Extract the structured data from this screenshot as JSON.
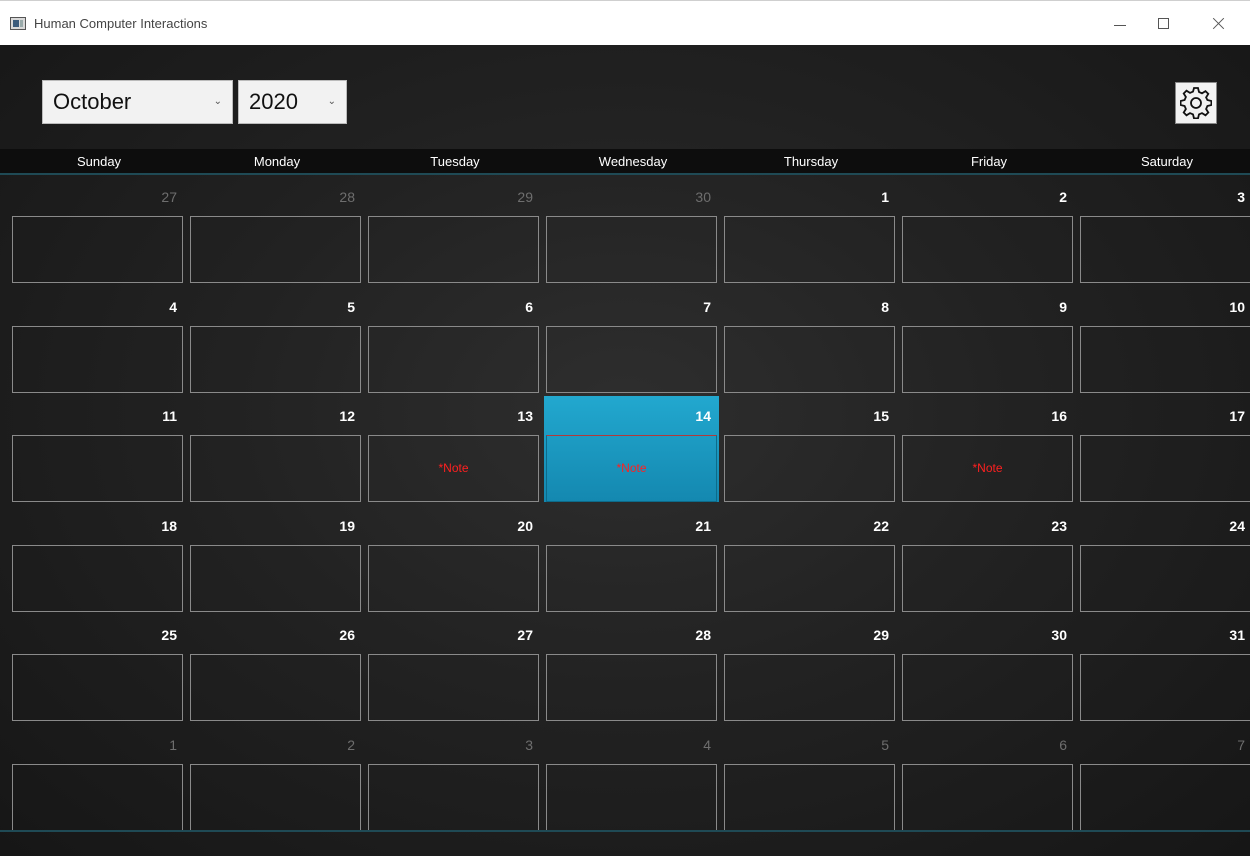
{
  "window": {
    "title": "Human Computer Interactions",
    "minimize": "minimize",
    "maximize": "maximize",
    "close": "close"
  },
  "controls": {
    "month": "October",
    "year": "2020",
    "settings_icon": "gear-icon"
  },
  "weekdays": [
    "Sunday",
    "Monday",
    "Tuesday",
    "Wednesday",
    "Thursday",
    "Friday",
    "Saturday"
  ],
  "colors": {
    "selected": "#1a9cc4",
    "note": "#ff2020",
    "muted": "#6e6e6e"
  },
  "calendar": {
    "selected_day": 14,
    "weeks": [
      [
        {
          "day": "27",
          "muted": true,
          "note": ""
        },
        {
          "day": "28",
          "muted": true,
          "note": ""
        },
        {
          "day": "29",
          "muted": true,
          "note": ""
        },
        {
          "day": "30",
          "muted": true,
          "note": ""
        },
        {
          "day": "1",
          "muted": false,
          "note": ""
        },
        {
          "day": "2",
          "muted": false,
          "note": ""
        },
        {
          "day": "3",
          "muted": false,
          "note": ""
        }
      ],
      [
        {
          "day": "4",
          "muted": false,
          "note": ""
        },
        {
          "day": "5",
          "muted": false,
          "note": ""
        },
        {
          "day": "6",
          "muted": false,
          "note": ""
        },
        {
          "day": "7",
          "muted": false,
          "note": ""
        },
        {
          "day": "8",
          "muted": false,
          "note": ""
        },
        {
          "day": "9",
          "muted": false,
          "note": ""
        },
        {
          "day": "10",
          "muted": false,
          "note": ""
        }
      ],
      [
        {
          "day": "11",
          "muted": false,
          "note": ""
        },
        {
          "day": "12",
          "muted": false,
          "note": ""
        },
        {
          "day": "13",
          "muted": false,
          "note": "*Note"
        },
        {
          "day": "14",
          "muted": false,
          "note": "*Note",
          "selected": true
        },
        {
          "day": "15",
          "muted": false,
          "note": ""
        },
        {
          "day": "16",
          "muted": false,
          "note": "*Note"
        },
        {
          "day": "17",
          "muted": false,
          "note": ""
        }
      ],
      [
        {
          "day": "18",
          "muted": false,
          "note": ""
        },
        {
          "day": "19",
          "muted": false,
          "note": ""
        },
        {
          "day": "20",
          "muted": false,
          "note": ""
        },
        {
          "day": "21",
          "muted": false,
          "note": ""
        },
        {
          "day": "22",
          "muted": false,
          "note": ""
        },
        {
          "day": "23",
          "muted": false,
          "note": ""
        },
        {
          "day": "24",
          "muted": false,
          "note": ""
        }
      ],
      [
        {
          "day": "25",
          "muted": false,
          "note": ""
        },
        {
          "day": "26",
          "muted": false,
          "note": ""
        },
        {
          "day": "27",
          "muted": false,
          "note": ""
        },
        {
          "day": "28",
          "muted": false,
          "note": ""
        },
        {
          "day": "29",
          "muted": false,
          "note": ""
        },
        {
          "day": "30",
          "muted": false,
          "note": ""
        },
        {
          "day": "31",
          "muted": false,
          "note": ""
        }
      ],
      [
        {
          "day": "1",
          "muted": true,
          "note": ""
        },
        {
          "day": "2",
          "muted": true,
          "note": ""
        },
        {
          "day": "3",
          "muted": true,
          "note": ""
        },
        {
          "day": "4",
          "muted": true,
          "note": ""
        },
        {
          "day": "5",
          "muted": true,
          "note": ""
        },
        {
          "day": "6",
          "muted": true,
          "note": ""
        },
        {
          "day": "7",
          "muted": true,
          "note": ""
        }
      ]
    ]
  }
}
